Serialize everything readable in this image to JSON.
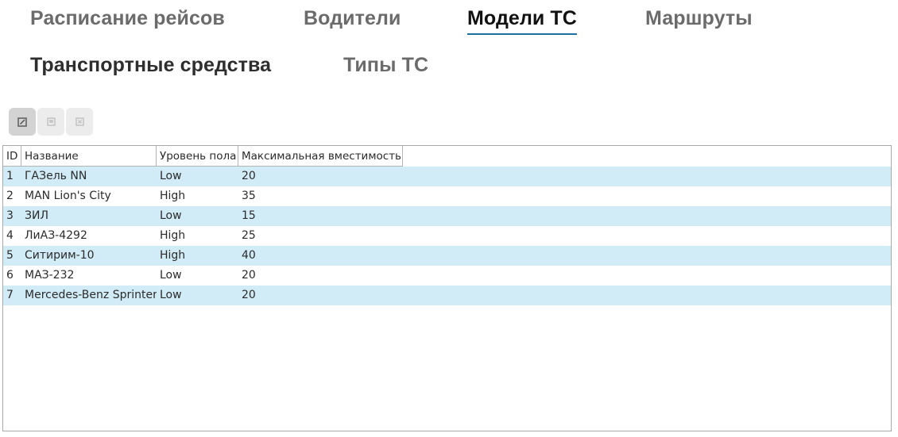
{
  "nav": {
    "tabs": [
      {
        "label": "Расписание рейсов",
        "active": false
      },
      {
        "label": "Водители",
        "active": false
      },
      {
        "label": "Модели ТС",
        "active": true
      },
      {
        "label": "Маршруты",
        "active": false
      },
      {
        "label": "Транспортные средства",
        "active": false
      },
      {
        "label": "Типы ТС",
        "active": false
      }
    ]
  },
  "toolbar": {
    "buttons": [
      {
        "icon": "edit-icon",
        "pressed": true
      },
      {
        "icon": "save-icon",
        "pressed": false
      },
      {
        "icon": "delete-icon",
        "pressed": false
      }
    ]
  },
  "table": {
    "columns": [
      "ID",
      "Название",
      "Уровень пола",
      "Максимальная вместимость"
    ],
    "rows": [
      {
        "id": "1",
        "name": "ГАЗель NN",
        "floor": "Low",
        "capacity": "20"
      },
      {
        "id": "2",
        "name": "MAN Lion's City",
        "floor": "High",
        "capacity": "35"
      },
      {
        "id": "3",
        "name": "ЗИЛ",
        "floor": "Low",
        "capacity": "15"
      },
      {
        "id": "4",
        "name": "ЛиАЗ-4292",
        "floor": "High",
        "capacity": "25"
      },
      {
        "id": "5",
        "name": "Ситирим-10",
        "floor": "High",
        "capacity": "40"
      },
      {
        "id": "6",
        "name": "МАЗ-232",
        "floor": "Low",
        "capacity": "20"
      },
      {
        "id": "7",
        "name": "Mercedes-Benz Sprinter",
        "floor": "Low",
        "capacity": "20"
      }
    ]
  },
  "colors": {
    "row_alt": "#d1ebf7",
    "active_underline": "#1e6f9f"
  }
}
